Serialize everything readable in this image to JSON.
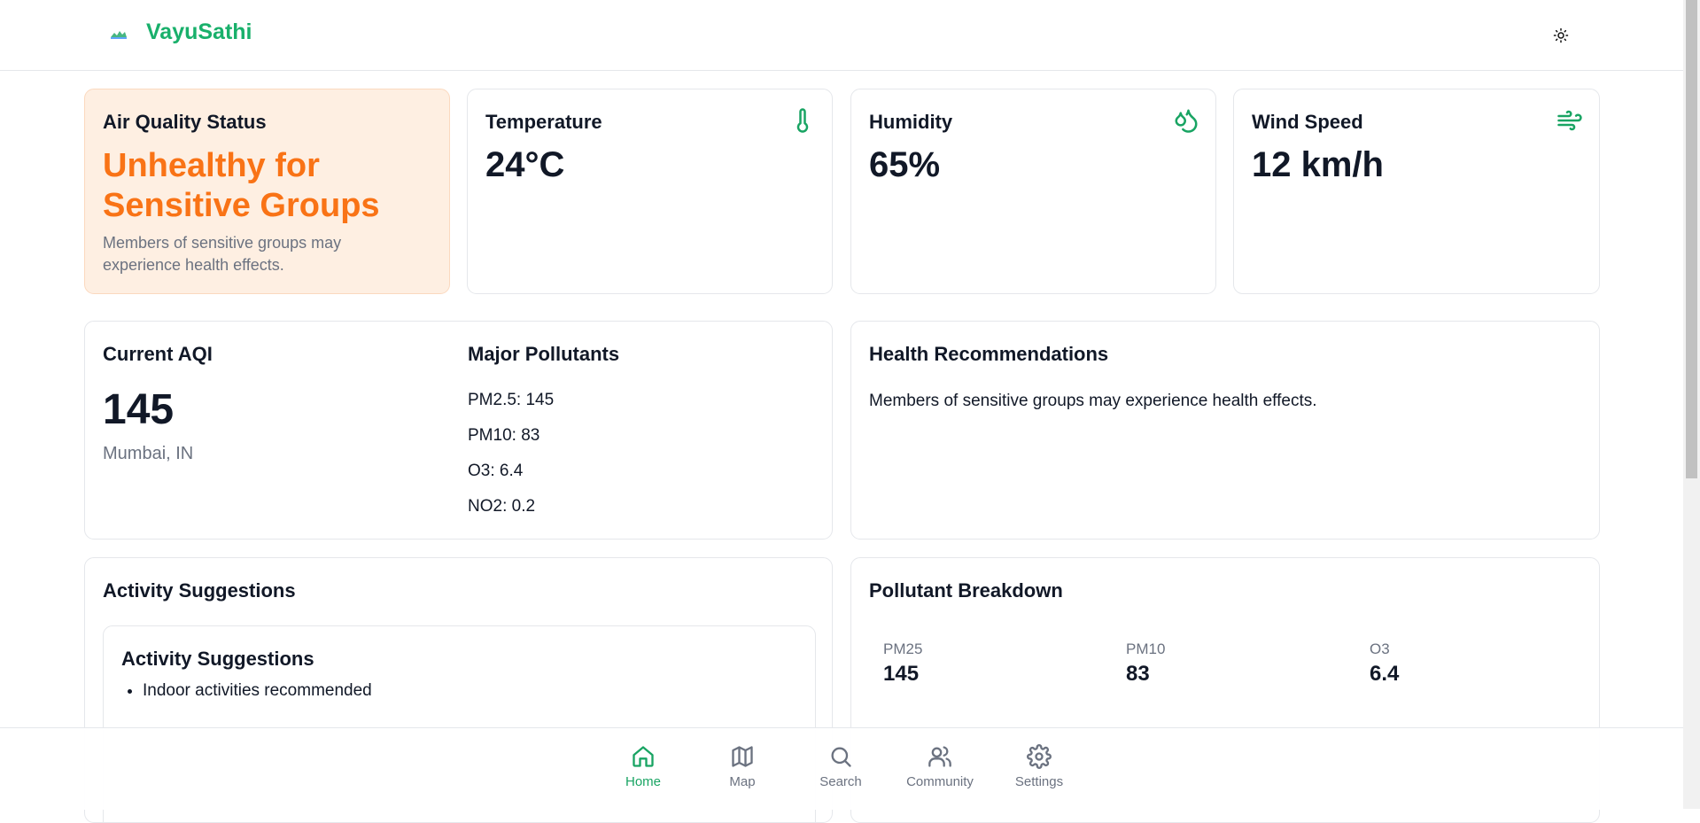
{
  "header": {
    "brand": "VayuSathi"
  },
  "colors": {
    "accent": "#19a463",
    "aqi_status": "#f97316",
    "aq_card_bg": "#feefe2"
  },
  "air_quality": {
    "title": "Air Quality Status",
    "status": "Unhealthy for Sensitive Groups",
    "description": "Members of sensitive groups may experience health effects."
  },
  "weather": {
    "temperature": {
      "label": "Temperature",
      "value": "24°C",
      "icon": "thermometer-icon"
    },
    "humidity": {
      "label": "Humidity",
      "value": "65%",
      "icon": "droplets-icon"
    },
    "wind": {
      "label": "Wind Speed",
      "value": "12 km/h",
      "icon": "wind-icon"
    }
  },
  "aqi": {
    "title": "Current AQI",
    "value": "145",
    "location": "Mumbai, IN",
    "pollutants_title": "Major Pollutants",
    "pollutants": [
      "PM2.5: 145",
      "PM10: 83",
      "O3: 6.4",
      "NO2: 0.2"
    ]
  },
  "health": {
    "title": "Health Recommendations",
    "text": "Members of sensitive groups may experience health effects."
  },
  "activity": {
    "title": "Activity Suggestions",
    "inner_title": "Activity Suggestions",
    "items": [
      "Indoor activities recommended"
    ]
  },
  "breakdown": {
    "title": "Pollutant Breakdown",
    "items": [
      {
        "label": "PM25",
        "value": "145"
      },
      {
        "label": "PM10",
        "value": "83"
      },
      {
        "label": "O3",
        "value": "6.4"
      }
    ]
  },
  "nav": {
    "items": [
      {
        "label": "Home",
        "icon": "home-icon",
        "active": true
      },
      {
        "label": "Map",
        "icon": "map-icon"
      },
      {
        "label": "Search",
        "icon": "search-icon"
      },
      {
        "label": "Community",
        "icon": "users-icon"
      },
      {
        "label": "Settings",
        "icon": "settings-icon"
      }
    ]
  }
}
